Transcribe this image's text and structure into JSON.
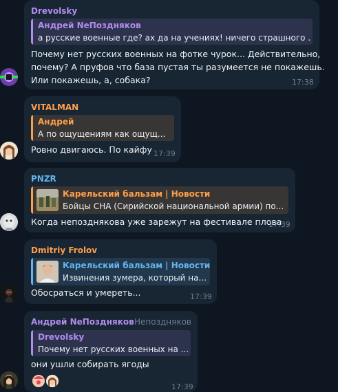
{
  "messages": [
    {
      "sender": "Drevolsky",
      "reply": {
        "title": "Андрей NeПоздняков",
        "text": "а русские военные где? ах да на учениях! ничего страшного ..."
      },
      "text_lines": [
        "Почему нет русских военных на фотке чурок... Действительно,",
        "почему? А пруфов что база пустая ты разумеется не покажешь.",
        "Или покажешь, а, собака?"
      ],
      "time": "17:38"
    },
    {
      "sender": "VITALMAN",
      "reply": {
        "title": "Андрей",
        "text": "А по ощущениям как ощущ..."
      },
      "text": "Ровно двигаюсь. По кайфу",
      "time": "17:39"
    },
    {
      "sender": "PNZR",
      "reply": {
        "title": "Карельский бальзам | Новости",
        "text": "Бойцы СНА (Сирийской национальной армии) по..."
      },
      "text": "Когда непозднякова уже зарежут на фестивале плова",
      "time": "17:39"
    },
    {
      "sender": "Dmitriy Frolov",
      "reply": {
        "title": "Карельский бальзам | Новости",
        "text": "Извинения зумера, который на..."
      },
      "text": "Обосраться и умереть...",
      "time": "17:39"
    },
    {
      "sender": "Андрей NeПоздняков",
      "sender_tag": "Непоздняков",
      "reply": {
        "title": "Drevolsky",
        "text": "Почему нет русских военных на ..."
      },
      "text": "они ушли собирать ягоды",
      "time": "17:39"
    }
  ],
  "colors": {
    "background": "#0e1621",
    "bubble": "#182533",
    "purple": "#b38cf0",
    "orange": "#ff9f4a",
    "blue": "#64b5ef",
    "red": "#ee6b6b",
    "time": "#6d7f8f"
  }
}
